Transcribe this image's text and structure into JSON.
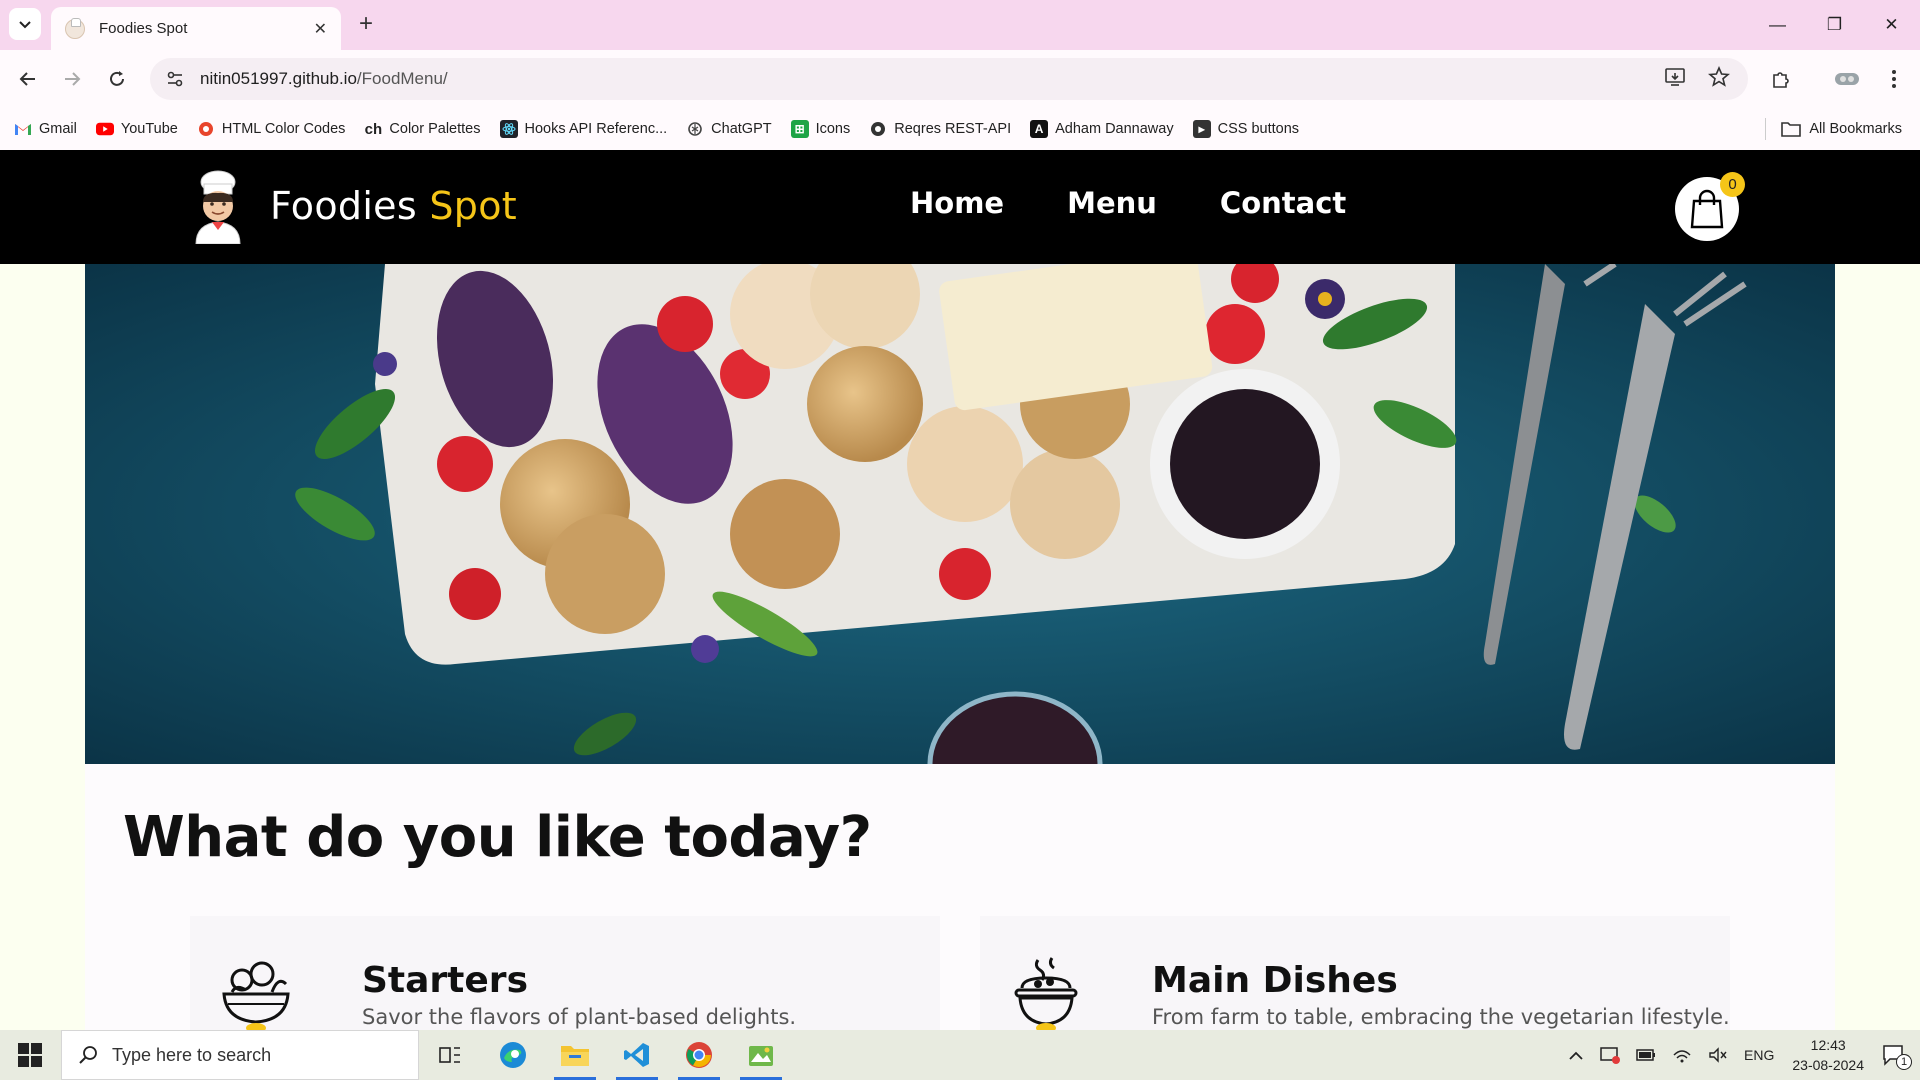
{
  "browser": {
    "tab": {
      "title": "Foodies Spot"
    },
    "url": {
      "host": "nitin051997.github.io",
      "path": "/FoodMenu/"
    },
    "bookmarks": [
      {
        "label": "Gmail",
        "icon": "gmail-icon"
      },
      {
        "label": "YouTube",
        "icon": "youtube-icon"
      },
      {
        "label": "HTML Color Codes",
        "icon": "html-color-codes-icon"
      },
      {
        "label": "Color Palettes",
        "icon": "color-palettes-icon"
      },
      {
        "label": "Hooks API Referenc...",
        "icon": "react-icon"
      },
      {
        "label": "ChatGPT",
        "icon": "chatgpt-icon"
      },
      {
        "label": "Icons",
        "icon": "icons-icon"
      },
      {
        "label": "Reqres REST-API",
        "icon": "reqres-icon"
      },
      {
        "label": "Adham Dannaway",
        "icon": "adham-icon"
      },
      {
        "label": "CSS buttons",
        "icon": "css-buttons-icon"
      }
    ],
    "all_bookmarks": "All Bookmarks"
  },
  "site": {
    "brand": {
      "main": "Foodies",
      "accent": "Spot"
    },
    "nav": [
      "Home",
      "Menu",
      "Contact"
    ],
    "cart_count": "0",
    "headline": "What do you like today?",
    "cards": [
      {
        "title": "Starters",
        "desc": "Savor the flavors of plant-based delights.",
        "icon": "salad-bowl-icon"
      },
      {
        "title": "Main Dishes",
        "desc": "From farm to table, embracing the vegetarian lifestyle.",
        "icon": "cooking-pot-icon"
      }
    ],
    "colors": {
      "accent": "#f5c518",
      "header_bg": "#000000",
      "hero_bg": "#124b62"
    }
  },
  "taskbar": {
    "search_placeholder": "Type here to search",
    "language": "ENG",
    "time": "12:43",
    "date": "23-08-2024",
    "notification_count": "1"
  }
}
